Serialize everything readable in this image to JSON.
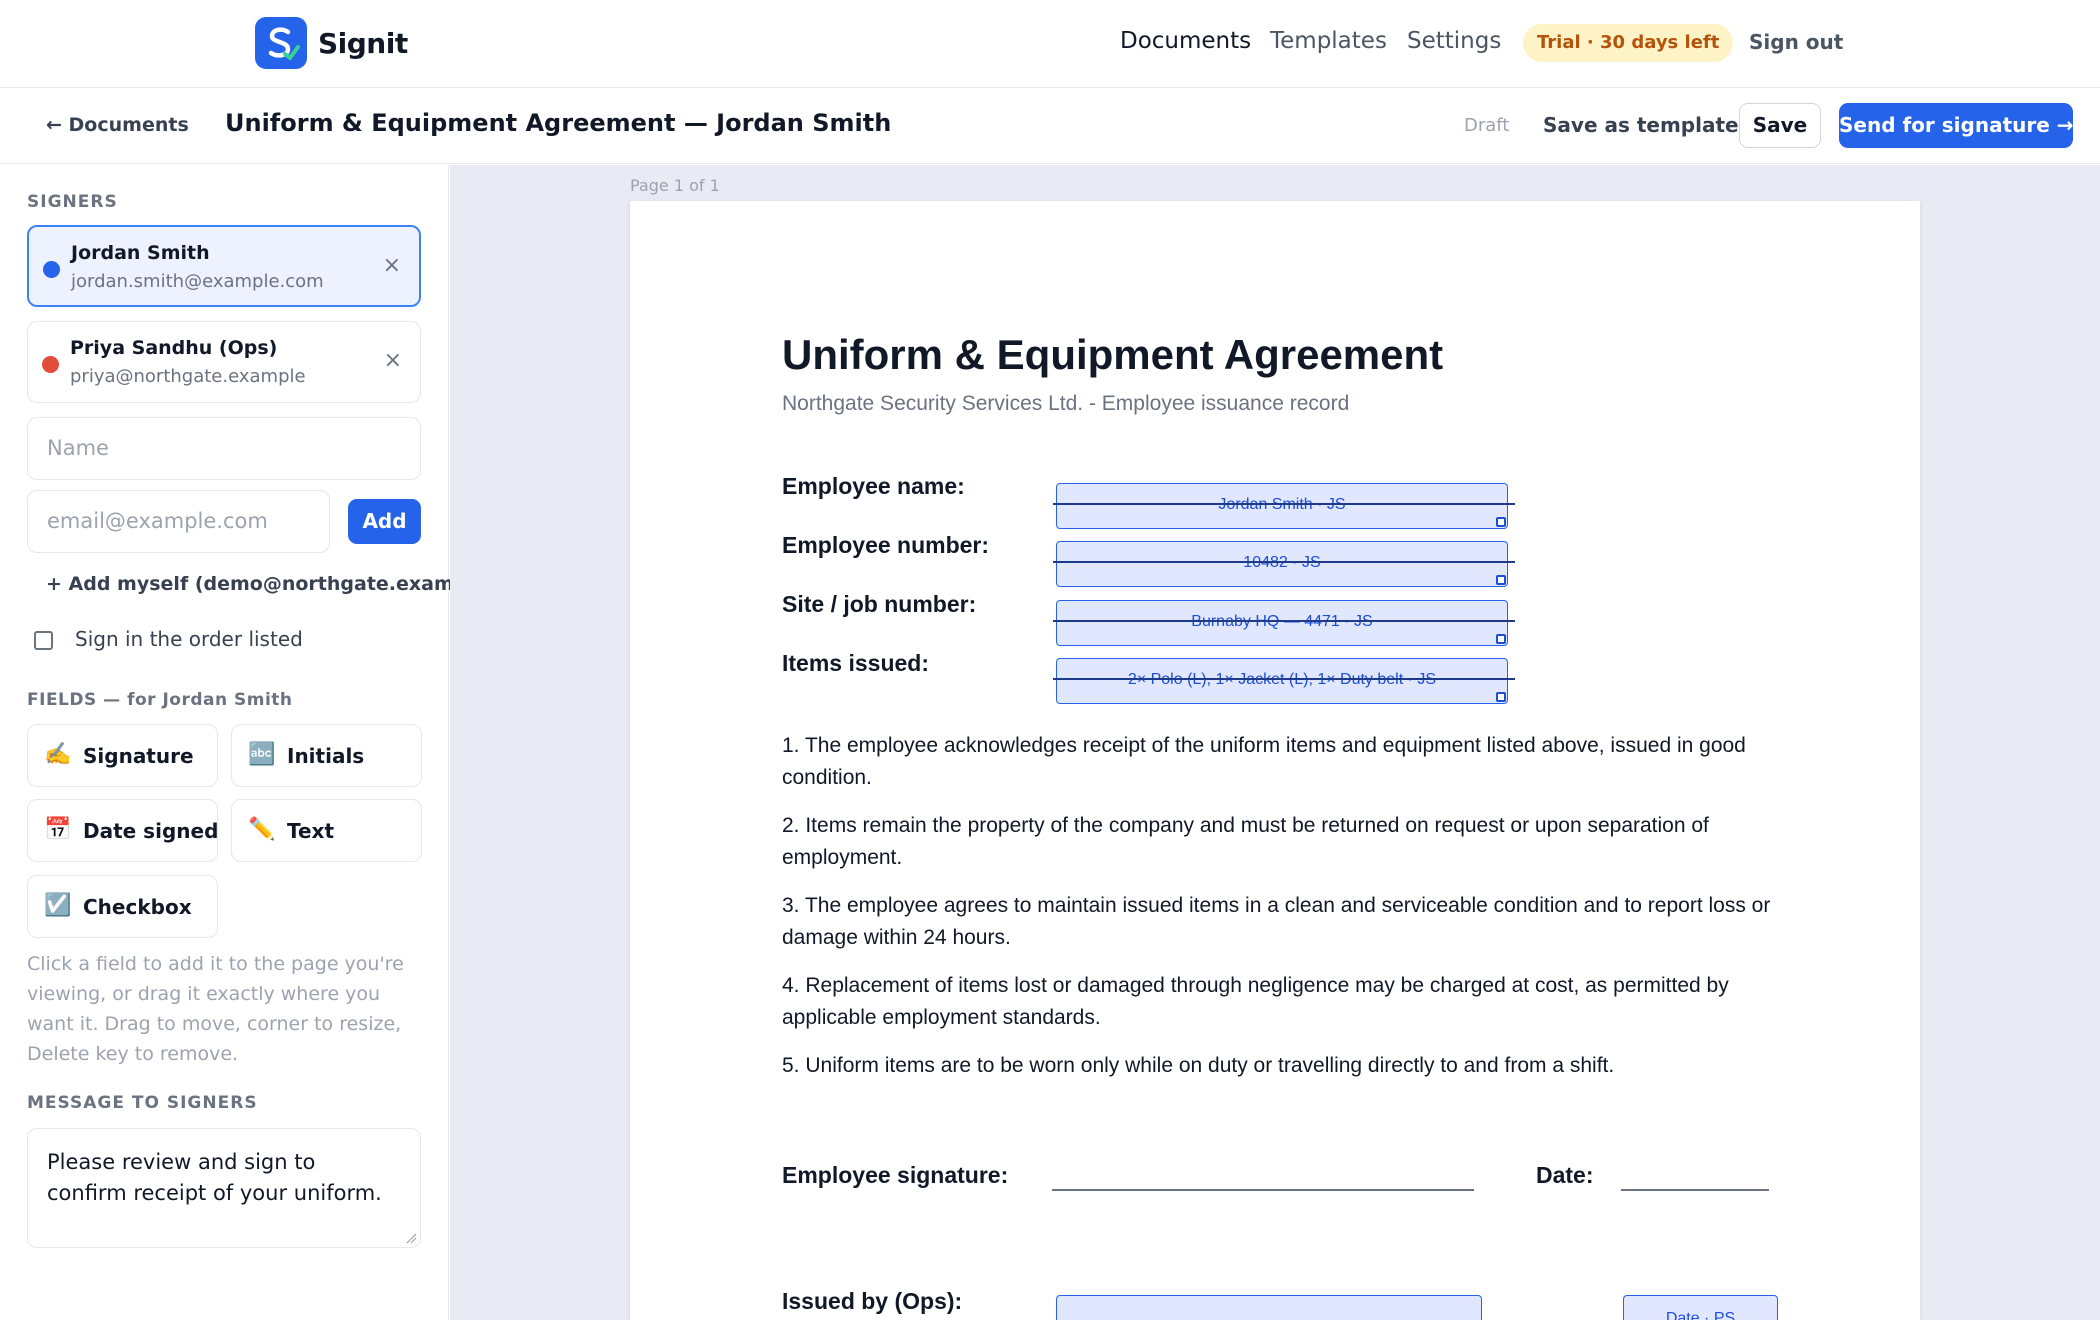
{
  "brand": {
    "name": "Signit"
  },
  "nav": {
    "items": [
      "Documents",
      "Templates",
      "Settings"
    ],
    "active": "Documents",
    "trial_badge": "Trial · 30 days left",
    "sign_out": "Sign out"
  },
  "subheader": {
    "back": "← Documents",
    "title": "Uniform & Equipment Agreement — Jordan Smith",
    "status": "Draft",
    "save_template": "Save as template",
    "save": "Save",
    "send": "Send for signature →"
  },
  "sidebar": {
    "signers_label": "SIGNERS",
    "signers": [
      {
        "name": "Jordan Smith",
        "email": "jordan.smith@example.com",
        "color": "#2563eb",
        "selected": true
      },
      {
        "name": "Priya Sandhu (Ops)",
        "email": "priya@northgate.example",
        "color": "#e14d3a",
        "selected": false
      }
    ],
    "remove_glyph": "×",
    "name_placeholder": "Name",
    "email_placeholder": "email@example.com",
    "add_button": "Add",
    "add_myself": "+ Add myself (demo@northgate.example)",
    "order_checkbox_label": "Sign in the order listed",
    "order_checked": false,
    "fields_label": "FIELDS — for Jordan Smith",
    "fields": [
      {
        "label": "Signature",
        "icon": "writing-hand-icon",
        "glyph": "✍️"
      },
      {
        "label": "Initials",
        "icon": "abc-icon",
        "glyph": "🔤"
      },
      {
        "label": "Date signed",
        "icon": "calendar-icon",
        "glyph": "📅"
      },
      {
        "label": "Text",
        "icon": "pencil-icon",
        "glyph": "✏️"
      },
      {
        "label": "Checkbox",
        "icon": "checkbox-icon",
        "glyph": "☑️"
      }
    ],
    "help": "Click a field to add it to the page you're viewing, or drag it exactly where you want it. Drag to move, corner to resize, Delete key to remove.",
    "message_label": "MESSAGE TO SIGNERS",
    "message": "Please review and sign to confirm receipt of your uniform."
  },
  "document": {
    "page_indicator": "Page 1 of 1",
    "heading": "Uniform & Equipment Agreement",
    "subheading": "Northgate Security Services Ltd. - Employee issuance record",
    "rows": [
      {
        "label": "Employee name:",
        "value": "Jordan Smith · JS"
      },
      {
        "label": "Employee number:",
        "value": "10482 · JS"
      },
      {
        "label": "Site / job number:",
        "value": "Burnaby HQ — 4471 · JS"
      },
      {
        "label": "Items issued:",
        "value": "2× Polo (L), 1× Jacket (L), 1× Duty belt · JS"
      }
    ],
    "clauses": [
      "1. The employee acknowledges receipt of the uniform items and equipment listed above, issued in good condition.",
      "2. Items remain the property of the company and must be returned on request or upon separation of employment.",
      "3. The employee agrees to maintain issued items in a clean and serviceable condition and to report loss or damage within 24 hours.",
      "4. Replacement of items lost or damaged through negligence may be charged at cost, as permitted by applicable employment standards.",
      "5. Uniform items are to be worn only while on duty or travelling directly to and from a shift."
    ],
    "employee_signature_label": "Employee signature:",
    "date_label": "Date:",
    "issued_by_label": "Issued by (Ops):",
    "issued_date_field": "Date · PS"
  }
}
